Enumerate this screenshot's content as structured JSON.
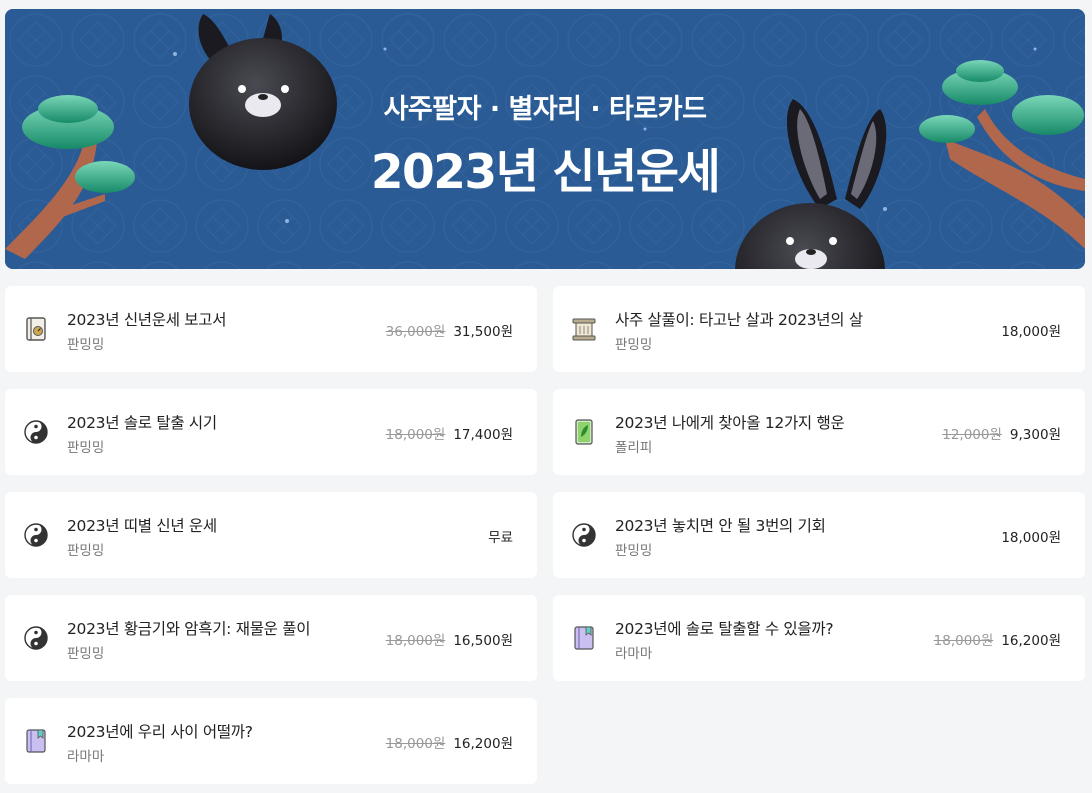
{
  "banner": {
    "subtitle": "사주팔자 · 별자리 · 타로카드",
    "title": "2023년 신년운세"
  },
  "products": [
    {
      "title": "2023년 신년운세 보고서",
      "author": "판밍밍",
      "old_price": "36,000원",
      "price": "31,500원",
      "icon": "book-gauge-icon"
    },
    {
      "title": "사주 살풀이: 타고난 살과 2023년의 살",
      "author": "판밍밍",
      "old_price": "",
      "price": "18,000원",
      "icon": "scroll-icon"
    },
    {
      "title": "2023년 솔로 탈출 시기",
      "author": "판밍밍",
      "old_price": "18,000원",
      "price": "17,400원",
      "icon": "yin-yang-icon"
    },
    {
      "title": "2023년 나에게 찾아올 12가지 행운",
      "author": "폴리피",
      "old_price": "12,000원",
      "price": "9,300원",
      "icon": "leaf-card-icon"
    },
    {
      "title": "2023년 띠별 신년 운세",
      "author": "판밍밍",
      "old_price": "",
      "price": "무료",
      "icon": "yin-yang-icon"
    },
    {
      "title": "2023년 놓치면 안 될 3번의 기회",
      "author": "판밍밍",
      "old_price": "",
      "price": "18,000원",
      "icon": "yin-yang-icon"
    },
    {
      "title": "2023년 황금기와 암흑기: 재물운 풀이",
      "author": "판밍밍",
      "old_price": "18,000원",
      "price": "16,500원",
      "icon": "yin-yang-icon"
    },
    {
      "title": "2023년에 솔로 탈출할 수 있을까?",
      "author": "라마마",
      "old_price": "18,000원",
      "price": "16,200원",
      "icon": "notebook-icon"
    },
    {
      "title": "2023년에 우리 사이 어떨까?",
      "author": "라마마",
      "old_price": "18,000원",
      "price": "16,200원",
      "icon": "notebook-icon"
    }
  ]
}
